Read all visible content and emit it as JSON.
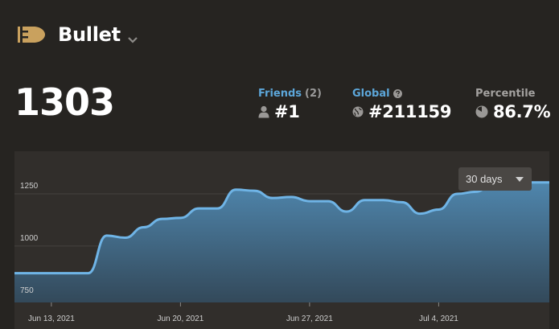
{
  "header": {
    "title": "Bullet",
    "icon": "bullet-icon",
    "dropdown_icon": "chevron-down-icon"
  },
  "rating": "1303",
  "stats": {
    "friends": {
      "label": "Friends",
      "count": "(2)",
      "value": "#1",
      "icon": "person-icon"
    },
    "global": {
      "label": "Global",
      "value": "#211159",
      "icon": "globe-icon",
      "help_icon": "question-icon"
    },
    "percentile": {
      "label": "Percentile",
      "value": "86.7%",
      "icon": "pie-icon"
    }
  },
  "range_selector": {
    "selected": "30 days"
  },
  "colors": {
    "background": "#262421",
    "chart_bg": "#312e2b",
    "accent": "#5ca6d9",
    "line": "#6fb4e6"
  },
  "chart_data": {
    "type": "area",
    "xlabel": "",
    "ylabel": "",
    "ylim": [
      730,
      1300
    ],
    "y_ticks": [
      {
        "value": 750,
        "label": "750"
      },
      {
        "value": 1000,
        "label": "1000"
      },
      {
        "value": 1250,
        "label": "1250"
      }
    ],
    "x_ticks": [
      {
        "value": "2021-06-13",
        "label": "Jun 13, 2021"
      },
      {
        "value": "2021-06-20",
        "label": "Jun 20, 2021"
      },
      {
        "value": "2021-06-27",
        "label": "Jun 27, 2021"
      },
      {
        "value": "2021-07-04",
        "label": "Jul 4, 2021"
      }
    ],
    "xlim": [
      "2021-06-11",
      "2021-07-10"
    ],
    "grid": true,
    "series": [
      {
        "x": [
          "2021-06-11",
          "2021-06-12",
          "2021-06-13",
          "2021-06-14",
          "2021-06-15",
          "2021-06-16",
          "2021-06-17",
          "2021-06-18",
          "2021-06-19",
          "2021-06-20",
          "2021-06-21",
          "2021-06-22",
          "2021-06-23",
          "2021-06-24",
          "2021-06-25",
          "2021-06-26",
          "2021-06-27",
          "2021-06-28",
          "2021-06-29",
          "2021-06-30",
          "2021-07-01",
          "2021-07-02",
          "2021-07-03",
          "2021-07-04",
          "2021-07-05",
          "2021-07-06",
          "2021-07-07",
          "2021-07-08",
          "2021-07-09",
          "2021-07-10"
        ],
        "values": [
          870,
          870,
          870,
          870,
          870,
          1050,
          1040,
          1090,
          1130,
          1135,
          1180,
          1180,
          1270,
          1265,
          1230,
          1235,
          1215,
          1215,
          1165,
          1220,
          1220,
          1210,
          1155,
          1175,
          1250,
          1260,
          1305,
          1305,
          1305,
          1305
        ]
      }
    ]
  }
}
